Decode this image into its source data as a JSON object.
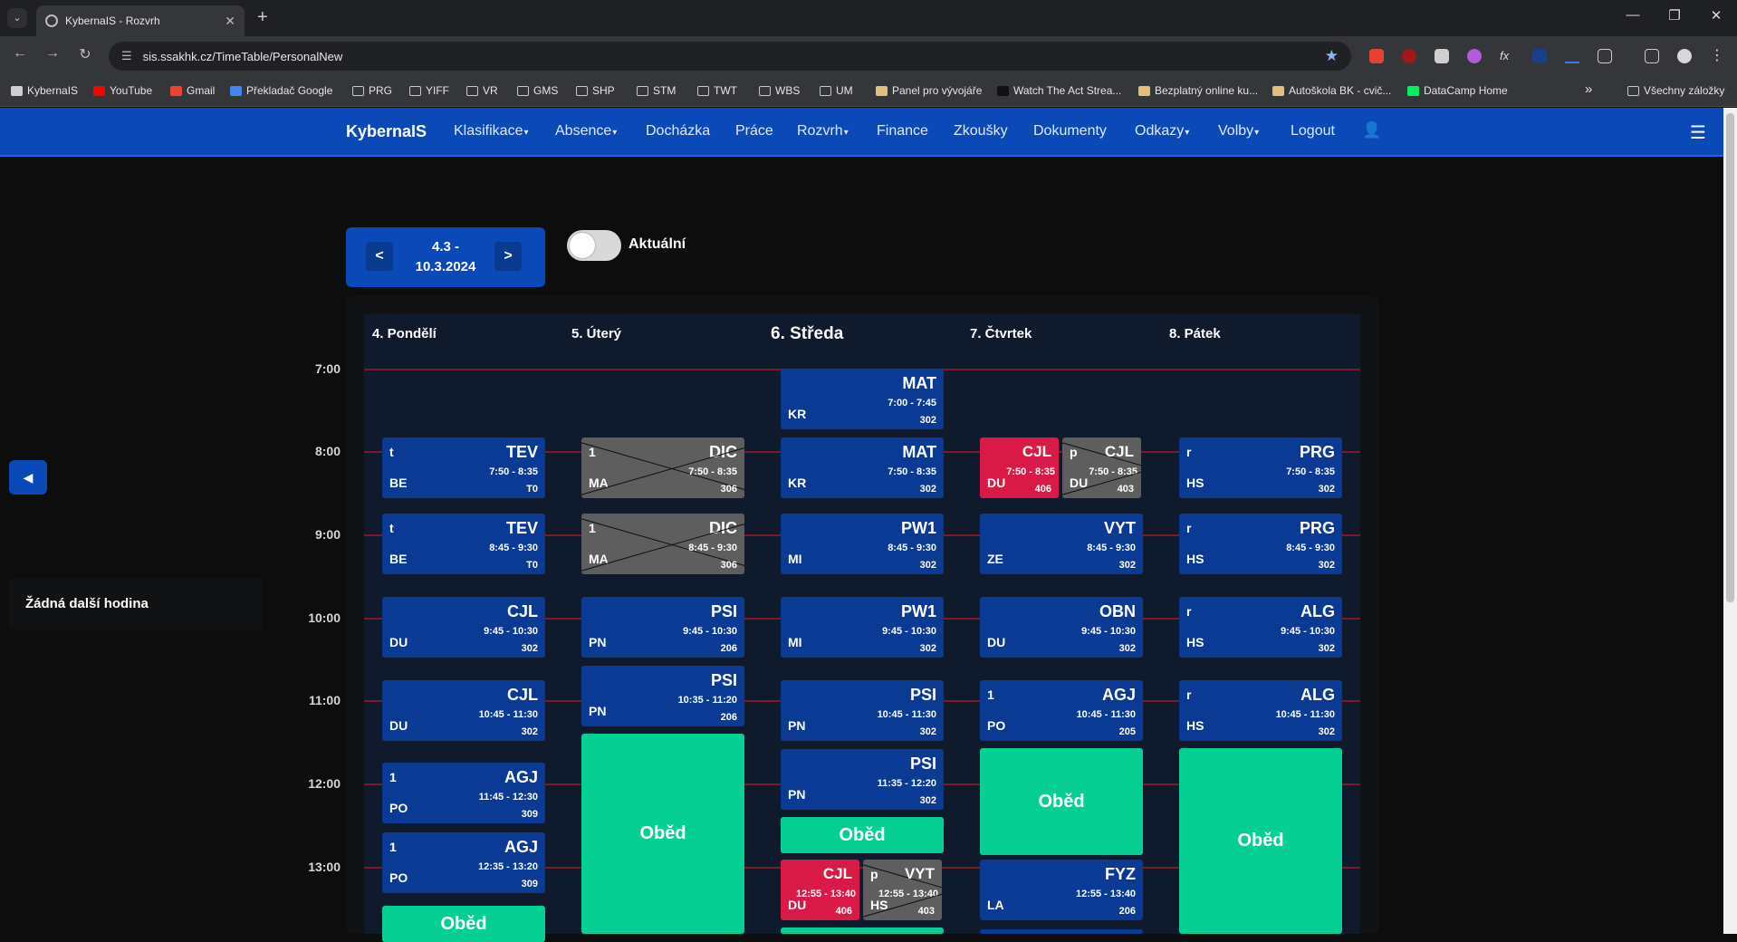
{
  "browser": {
    "tab_title": "KybernaIS - Rozvrh",
    "url": "sis.ssakhk.cz/TimeTable/PersonalNew",
    "bookmarks": [
      {
        "label": "KybernaIS",
        "icon": "kyberna-icon"
      },
      {
        "label": "YouTube",
        "icon": "youtube-icon"
      },
      {
        "label": "Gmail",
        "icon": "gmail-icon"
      },
      {
        "label": "Překladač Google",
        "icon": "google-translate-icon"
      },
      {
        "label": "PRG",
        "icon": "folder-icon"
      },
      {
        "label": "YIFF",
        "icon": "folder-icon"
      },
      {
        "label": "VR",
        "icon": "folder-icon"
      },
      {
        "label": "GMS",
        "icon": "folder-icon"
      },
      {
        "label": "SHP",
        "icon": "folder-icon"
      },
      {
        "label": "STM",
        "icon": "folder-icon"
      },
      {
        "label": "TWT",
        "icon": "folder-icon"
      },
      {
        "label": "WBS",
        "icon": "folder-icon"
      },
      {
        "label": "UM",
        "icon": "folder-icon"
      },
      {
        "label": "Panel pro vývojáře",
        "icon": "page-icon"
      },
      {
        "label": "Watch The Act Strea...",
        "icon": "hulu-icon"
      },
      {
        "label": "Bezplatný online ku...",
        "icon": "page-icon"
      },
      {
        "label": "Autoškola BK - cvič...",
        "icon": "page-icon"
      },
      {
        "label": "DataCamp Home",
        "icon": "datacamp-icon"
      }
    ],
    "bookmarks_overflow": "»",
    "all_bookmarks": "Všechny záložky"
  },
  "navbar": {
    "brand": "KybernaIS",
    "items": [
      "Klasifikace",
      "Absence",
      "Docházka",
      "Práce",
      "Rozvrh",
      "Finance",
      "Zkoušky",
      "Dokumenty",
      "Odkazy",
      "Volby",
      "Logout"
    ],
    "dropdown_items": [
      "Klasifikace",
      "Absence",
      "Rozvrh",
      "Odkazy",
      "Volby"
    ]
  },
  "side": {
    "toggle": "◀",
    "next_lesson": "Žádná další hodina"
  },
  "week": {
    "prev": "<",
    "next": ">",
    "range_line1": "4.3 -",
    "range_line2": "10.3.2024",
    "current_toggle_label": "Aktuální",
    "current_toggle_on": false
  },
  "hours": [
    "7:00",
    "8:00",
    "9:00",
    "10:00",
    "11:00",
    "12:00",
    "13:00"
  ],
  "days": [
    {
      "label": "4. Pondělí",
      "today": false
    },
    {
      "label": "5. Úterý",
      "today": false
    },
    {
      "label": "6. Středa",
      "today": true
    },
    {
      "label": "7. Čtvrtek",
      "today": false
    },
    {
      "label": "8. Pátek",
      "today": false
    }
  ],
  "lessons": {
    "mon": [
      {
        "subj": "TEV",
        "grp": "t",
        "teacher": "BE",
        "time": "7:50 - 8:35",
        "room": "T0"
      },
      {
        "subj": "TEV",
        "grp": "t",
        "teacher": "BE",
        "time": "8:45 - 9:30",
        "room": "T0"
      },
      {
        "subj": "CJL",
        "grp": "",
        "teacher": "DU",
        "time": "9:45 - 10:30",
        "room": "302"
      },
      {
        "subj": "CJL",
        "grp": "",
        "teacher": "DU",
        "time": "10:45 - 11:30",
        "room": "302"
      },
      {
        "subj": "AGJ",
        "grp": "1",
        "teacher": "PO",
        "time": "11:45 - 12:30",
        "room": "309"
      },
      {
        "subj": "AGJ",
        "grp": "1",
        "teacher": "PO",
        "time": "12:35 - 13:20",
        "room": "309"
      }
    ],
    "tue": [
      {
        "subj": "DIC",
        "grp": "1",
        "teacher": "MA",
        "time": "7:50 - 8:35",
        "room": "306"
      },
      {
        "subj": "DIC",
        "grp": "1",
        "teacher": "MA",
        "time": "8:45 - 9:30",
        "room": "306"
      },
      {
        "subj": "PSI",
        "grp": "",
        "teacher": "PN",
        "time": "9:45 - 10:30",
        "room": "206"
      },
      {
        "subj": "PSI",
        "grp": "",
        "teacher": "PN",
        "time": "10:35 - 11:20",
        "room": "206"
      }
    ],
    "wed": [
      {
        "subj": "MAT",
        "grp": "",
        "teacher": "KR",
        "time": "7:00 - 7:45",
        "room": "302"
      },
      {
        "subj": "MAT",
        "grp": "",
        "teacher": "KR",
        "time": "7:50 - 8:35",
        "room": "302"
      },
      {
        "subj": "PW1",
        "grp": "",
        "teacher": "MI",
        "time": "8:45 - 9:30",
        "room": "302"
      },
      {
        "subj": "PW1",
        "grp": "",
        "teacher": "MI",
        "time": "9:45 - 10:30",
        "room": "302"
      },
      {
        "subj": "PSI",
        "grp": "",
        "teacher": "PN",
        "time": "10:45 - 11:30",
        "room": "302"
      },
      {
        "subj": "PSI",
        "grp": "",
        "teacher": "PN",
        "time": "11:35 - 12:20",
        "room": "302"
      },
      {
        "subj": "CJL",
        "grp": "",
        "teacher": "DU",
        "time": "12:55 - 13:40",
        "room": "406"
      },
      {
        "subj": "VYT",
        "grp": "p",
        "teacher": "HS",
        "time": "12:55 - 13:40",
        "room": "403"
      }
    ],
    "thu": [
      {
        "subj": "CJL",
        "grp": "",
        "teacher": "DU",
        "time": "7:50 - 8:35",
        "room": "406"
      },
      {
        "subj": "CJL",
        "grp": "p",
        "teacher": "DU",
        "time": "7:50 - 8:35",
        "room": "403"
      },
      {
        "subj": "VYT",
        "grp": "",
        "teacher": "ZE",
        "time": "8:45 - 9:30",
        "room": "302"
      },
      {
        "subj": "OBN",
        "grp": "",
        "teacher": "DU",
        "time": "9:45 - 10:30",
        "room": "302"
      },
      {
        "subj": "AGJ",
        "grp": "1",
        "teacher": "PO",
        "time": "10:45 - 11:30",
        "room": "205"
      },
      {
        "subj": "FYZ",
        "grp": "",
        "teacher": "LA",
        "time": "12:55 - 13:40",
        "room": "206"
      }
    ],
    "fri": [
      {
        "subj": "PRG",
        "grp": "r",
        "teacher": "HS",
        "time": "7:50 - 8:35",
        "room": "302"
      },
      {
        "subj": "PRG",
        "grp": "r",
        "teacher": "HS",
        "time": "8:45 - 9:30",
        "room": "302"
      },
      {
        "subj": "ALG",
        "grp": "r",
        "teacher": "HS",
        "time": "9:45 - 10:30",
        "room": "302"
      },
      {
        "subj": "ALG",
        "grp": "r",
        "teacher": "HS",
        "time": "10:45 - 11:30",
        "room": "302"
      }
    ]
  },
  "lunch_label": "Oběd",
  "colors": {
    "primary": "#0b49b9",
    "lesson": "#0a3a93",
    "cancelled": "#5e5e5e",
    "substitution": "#d91a46",
    "lunch": "#06cf93",
    "hour_line": "#7d1a2a"
  }
}
